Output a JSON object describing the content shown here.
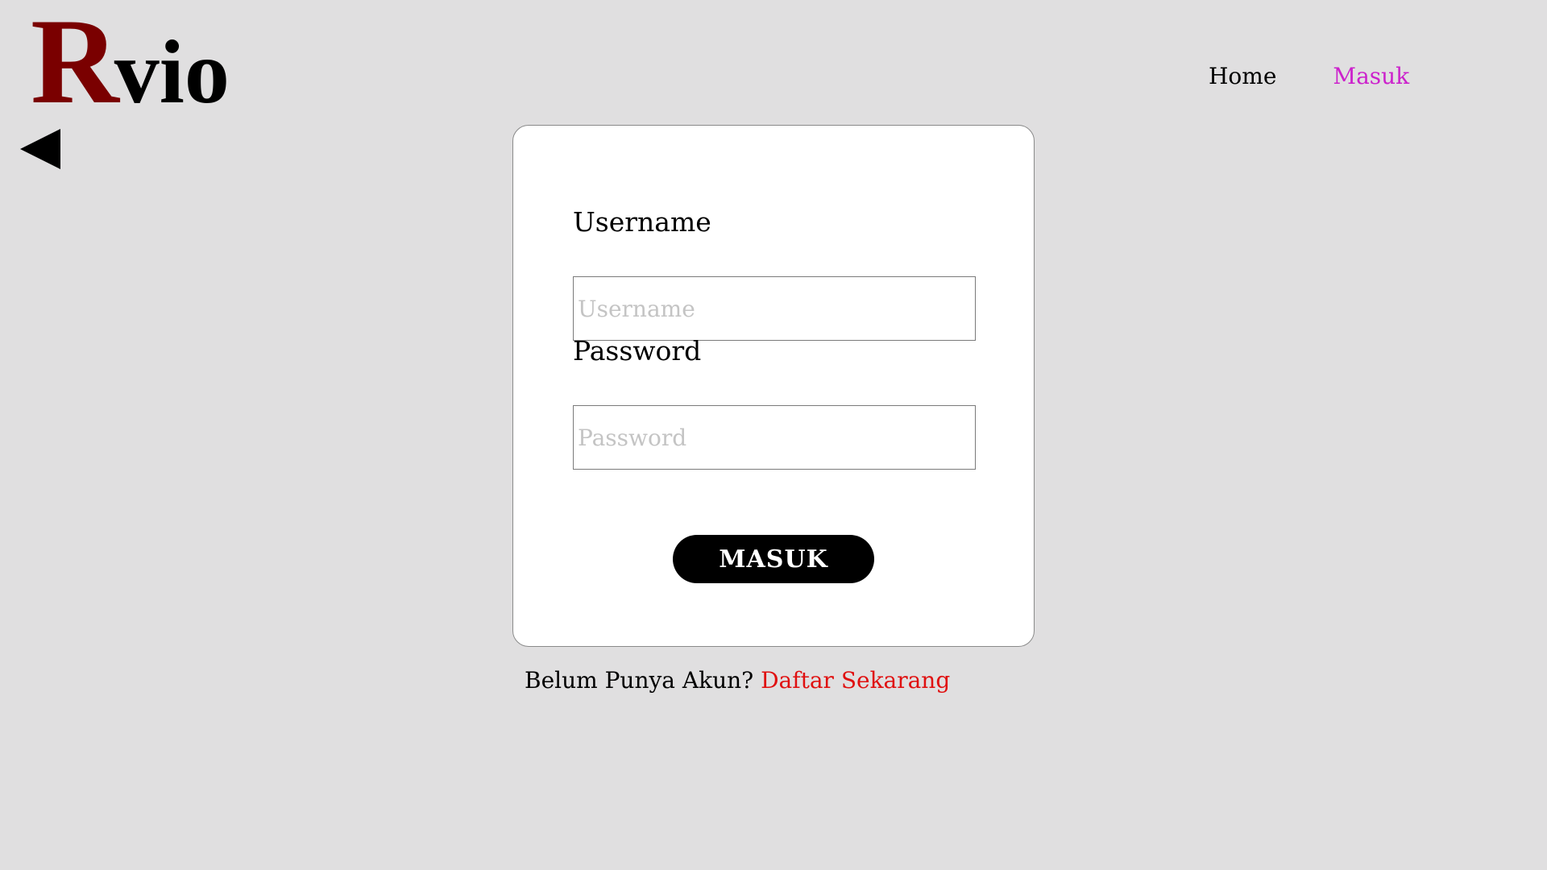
{
  "brand": {
    "first_letter": "R",
    "rest": "vio",
    "first_letter_color": "#7a0000"
  },
  "back": {
    "icon": "back-triangle-icon"
  },
  "nav": {
    "items": [
      {
        "label": "Home",
        "active": false
      },
      {
        "label": "Masuk",
        "active": true
      }
    ],
    "active_color": "#cc22cc"
  },
  "login": {
    "username_label": "Username",
    "username_placeholder": "Username",
    "username_value": "",
    "password_label": "Password",
    "password_placeholder": "Password",
    "password_value": "",
    "submit_label": "MASUK"
  },
  "signup": {
    "prompt": "Belum Punya Akun?",
    "link_label": "Daftar Sekarang",
    "link_color": "#e01010"
  }
}
